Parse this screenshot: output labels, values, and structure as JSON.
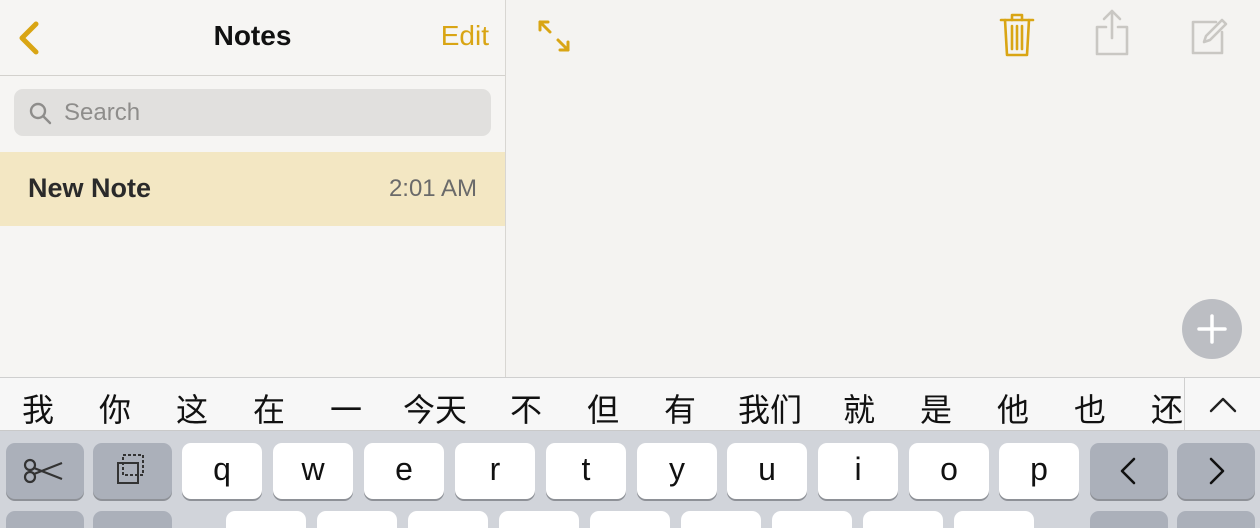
{
  "sidebar": {
    "title": "Notes",
    "edit_label": "Edit",
    "search": {
      "placeholder": "Search"
    },
    "notes": [
      {
        "title": "New Note",
        "time": "2:01 AM"
      }
    ]
  },
  "candidates": [
    "我",
    "你",
    "这",
    "在",
    "一",
    "今天",
    "不",
    "但",
    "有",
    "我们",
    "就",
    "是",
    "他",
    "也",
    "还"
  ],
  "keyboard": {
    "row1": [
      "q",
      "w",
      "e",
      "r",
      "t",
      "y",
      "u",
      "i",
      "o",
      "p"
    ]
  },
  "icons": {
    "back": "chevron-left-icon",
    "expand": "expand-arrows-icon",
    "trash": "trash-icon",
    "share": "share-icon",
    "compose": "compose-icon",
    "add": "plus-icon",
    "cut": "scissors-icon",
    "copy": "copy-icon",
    "left": "chevron-left-icon",
    "right": "chevron-right-icon",
    "candidates_expand": "chevron-up-icon"
  },
  "colors": {
    "accent": "#d9a514",
    "selected_note": "#f3e7c3",
    "keyboard_bg": "#d1d4da"
  }
}
